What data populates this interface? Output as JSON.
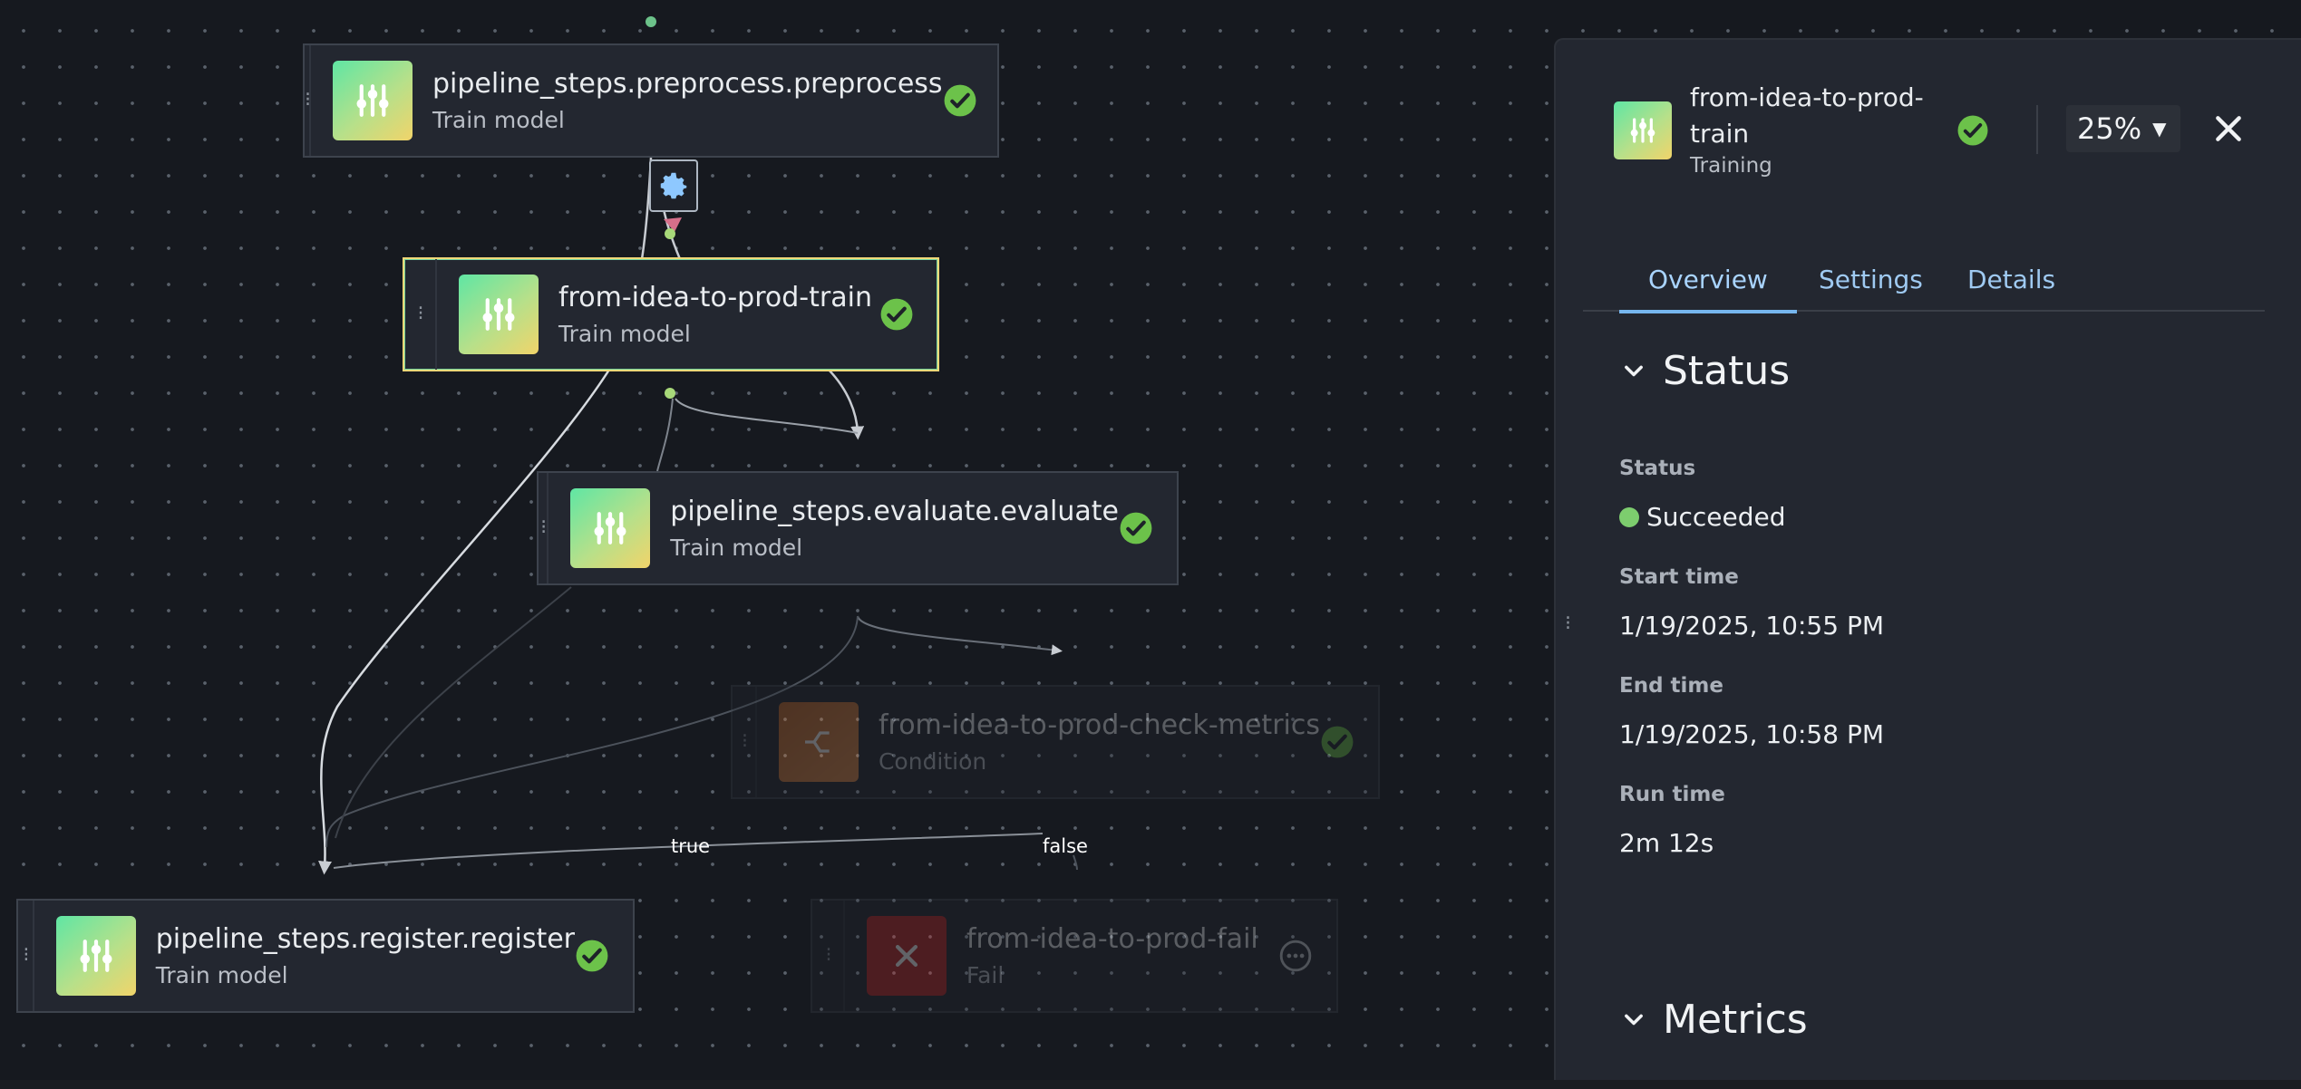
{
  "canvas": {
    "nodes": [
      {
        "title": "pipeline_steps.preprocess.preprocess",
        "subtitle": "Train model",
        "icon": "sliders-icon",
        "status": "succeeded"
      },
      {
        "title": "from-idea-to-prod-train",
        "subtitle": "Train model",
        "icon": "sliders-icon",
        "status": "succeeded",
        "selected": true
      },
      {
        "title": "pipeline_steps.evaluate.evaluate",
        "subtitle": "Train model",
        "icon": "sliders-icon",
        "status": "succeeded"
      },
      {
        "title": "from-idea-to-prod-check-metrics",
        "subtitle": "Condition",
        "icon": "condition-icon",
        "status": "succeeded"
      },
      {
        "title": "pipeline_steps.register.register",
        "subtitle": "Train model",
        "icon": "sliders-icon",
        "status": "succeeded"
      },
      {
        "title": "from-idea-to-prod-fail",
        "subtitle": "Fail",
        "icon": "x-icon",
        "status": "not-executed"
      }
    ],
    "edge_labels": {
      "true_label": "true",
      "false_label": "false"
    },
    "colors": {
      "success": "#6cc24a",
      "edge": "#c8ccd2",
      "accent": "#a9d4ff"
    }
  },
  "panel": {
    "title": "from-idea-to-prod-train",
    "subtitle": "Training",
    "zoom": "25%",
    "tabs": [
      {
        "label": "Overview"
      },
      {
        "label": "Settings"
      },
      {
        "label": "Details"
      }
    ],
    "status_section": {
      "heading": "Status",
      "status_label": "Status",
      "status_value": "Succeeded",
      "start_label": "Start time",
      "start_value": "1/19/2025, 10:55 PM",
      "end_label": "End time",
      "end_value": "1/19/2025, 10:58 PM",
      "runtime_label": "Run time",
      "runtime_value": "2m 12s"
    },
    "metrics_section": {
      "heading": "Metrics"
    }
  }
}
